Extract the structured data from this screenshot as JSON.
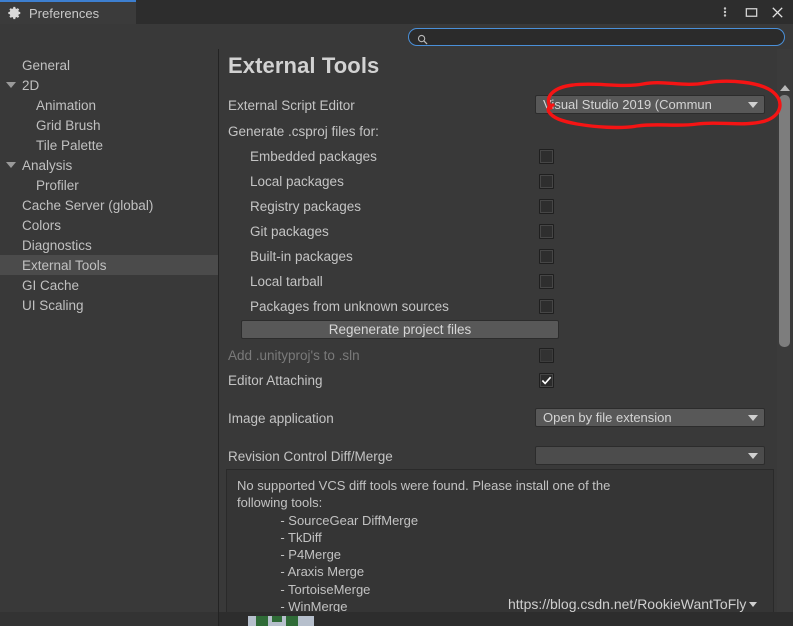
{
  "window": {
    "tab_label": "Preferences",
    "gear_icon": "gear-icon",
    "menu_icon": "kebab-menu-icon",
    "maximize_icon": "maximize-icon",
    "close_icon": "close-icon",
    "accent_color": "#3d7fd0"
  },
  "search": {
    "value": "",
    "placeholder": "",
    "icon": "search-icon",
    "focus_color": "#4a90d9"
  },
  "sidebar": {
    "items": [
      {
        "label": "General",
        "level": 0,
        "arrow": false,
        "selected": false
      },
      {
        "label": "2D",
        "level": 0,
        "arrow": true,
        "selected": false
      },
      {
        "label": "Animation",
        "level": 1,
        "arrow": false,
        "selected": false
      },
      {
        "label": "Grid Brush",
        "level": 1,
        "arrow": false,
        "selected": false
      },
      {
        "label": "Tile Palette",
        "level": 1,
        "arrow": false,
        "selected": false
      },
      {
        "label": "Analysis",
        "level": 0,
        "arrow": true,
        "selected": false
      },
      {
        "label": "Profiler",
        "level": 1,
        "arrow": false,
        "selected": false
      },
      {
        "label": "Cache Server (global)",
        "level": 0,
        "arrow": false,
        "selected": false
      },
      {
        "label": "Colors",
        "level": 0,
        "arrow": false,
        "selected": false
      },
      {
        "label": "Diagnostics",
        "level": 0,
        "arrow": false,
        "selected": false
      },
      {
        "label": "External Tools",
        "level": 0,
        "arrow": false,
        "selected": true
      },
      {
        "label": "GI Cache",
        "level": 0,
        "arrow": false,
        "selected": false
      },
      {
        "label": "UI Scaling",
        "level": 0,
        "arrow": false,
        "selected": false
      }
    ]
  },
  "main": {
    "title": "External Tools",
    "external_script_editor": {
      "label": "External Script Editor",
      "value": "Visual Studio 2019 (Commun"
    },
    "csproj": {
      "label": "Generate .csproj files for:",
      "options": [
        {
          "label": "Embedded packages",
          "checked": false
        },
        {
          "label": "Local packages",
          "checked": false
        },
        {
          "label": "Registry packages",
          "checked": false
        },
        {
          "label": "Git packages",
          "checked": false
        },
        {
          "label": "Built-in packages",
          "checked": false
        },
        {
          "label": "Local tarball",
          "checked": false
        },
        {
          "label": "Packages from unknown sources",
          "checked": false
        }
      ]
    },
    "regenerate_button": "Regenerate project files",
    "add_unityproj": {
      "label": "Add .unityproj's to .sln",
      "checked": false,
      "disabled": true
    },
    "editor_attaching": {
      "label": "Editor Attaching",
      "checked": true,
      "disabled": false
    },
    "image_application": {
      "label": "Image application",
      "value": "Open by file extension"
    },
    "revision_control": {
      "label": "Revision Control Diff/Merge",
      "value": ""
    },
    "help_box": "No supported VCS diff tools were found. Please install one of the\nfollowing tools:\n            - SourceGear DiffMerge\n            - TkDiff\n            - P4Merge\n            - Araxis Merge\n            - TortoiseMerge\n            - WinMerge"
  },
  "annotation": {
    "shape": "red-ellipse-highlight",
    "color": "#ff0000",
    "targets": "external-script-editor-dropdown"
  },
  "watermark": {
    "text": "https://blog.csdn.net/RookieWantToFly"
  },
  "scrollbar": {
    "name": "main-vertical-scrollbar"
  }
}
